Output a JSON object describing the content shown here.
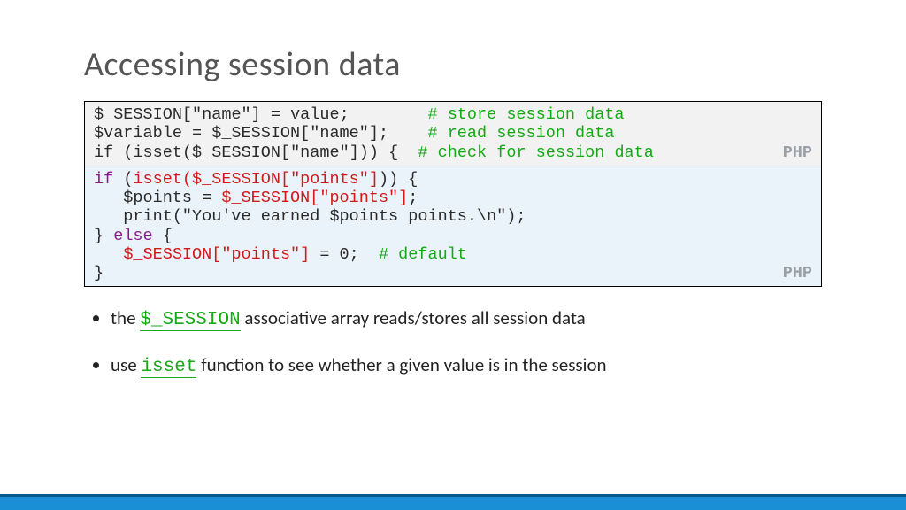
{
  "title": "Accessing session data",
  "lang_label": "PHP",
  "box1": {
    "l1a": "$_SESSION",
    "l1b": "[",
    "l1c": "\"name\"",
    "l1d": "] = value;        ",
    "l1e": "# store session data",
    "l2a": "$variable = $_SESSION[",
    "l2b": "\"name\"",
    "l2c": "];    ",
    "l2d": "# read session data",
    "l3a": "if",
    "l3b": " (",
    "l3c": "isset",
    "l3d": "($_SESSION[",
    "l3e": "\"name\"",
    "l3f": "])) {  ",
    "l3g": "# check for session data"
  },
  "box2": {
    "l1a": "if",
    "l1b": " (",
    "l1c": "isset($_SESSION[\"points\"]",
    "l1d": ")) {",
    "l2a": "   $points = ",
    "l2b": "$_SESSION[\"points\"]",
    "l2c": ";",
    "l3": "   print(\"You've earned $points points.\\n\");",
    "l4a": "} ",
    "l4b": "else",
    "l4c": " {",
    "l5a": "   ",
    "l5b": "$_SESSION[\"points\"]",
    "l5c": " = 0;  ",
    "l5d": "# default",
    "l6": "}"
  },
  "bullets": {
    "b1_pre": "the ",
    "b1_code": "$_SESSION",
    "b1_post": " associative array reads/stores all session data",
    "b2_pre": "use ",
    "b2_code": "isset",
    "b2_post": " function to see whether a given value is in the session"
  }
}
